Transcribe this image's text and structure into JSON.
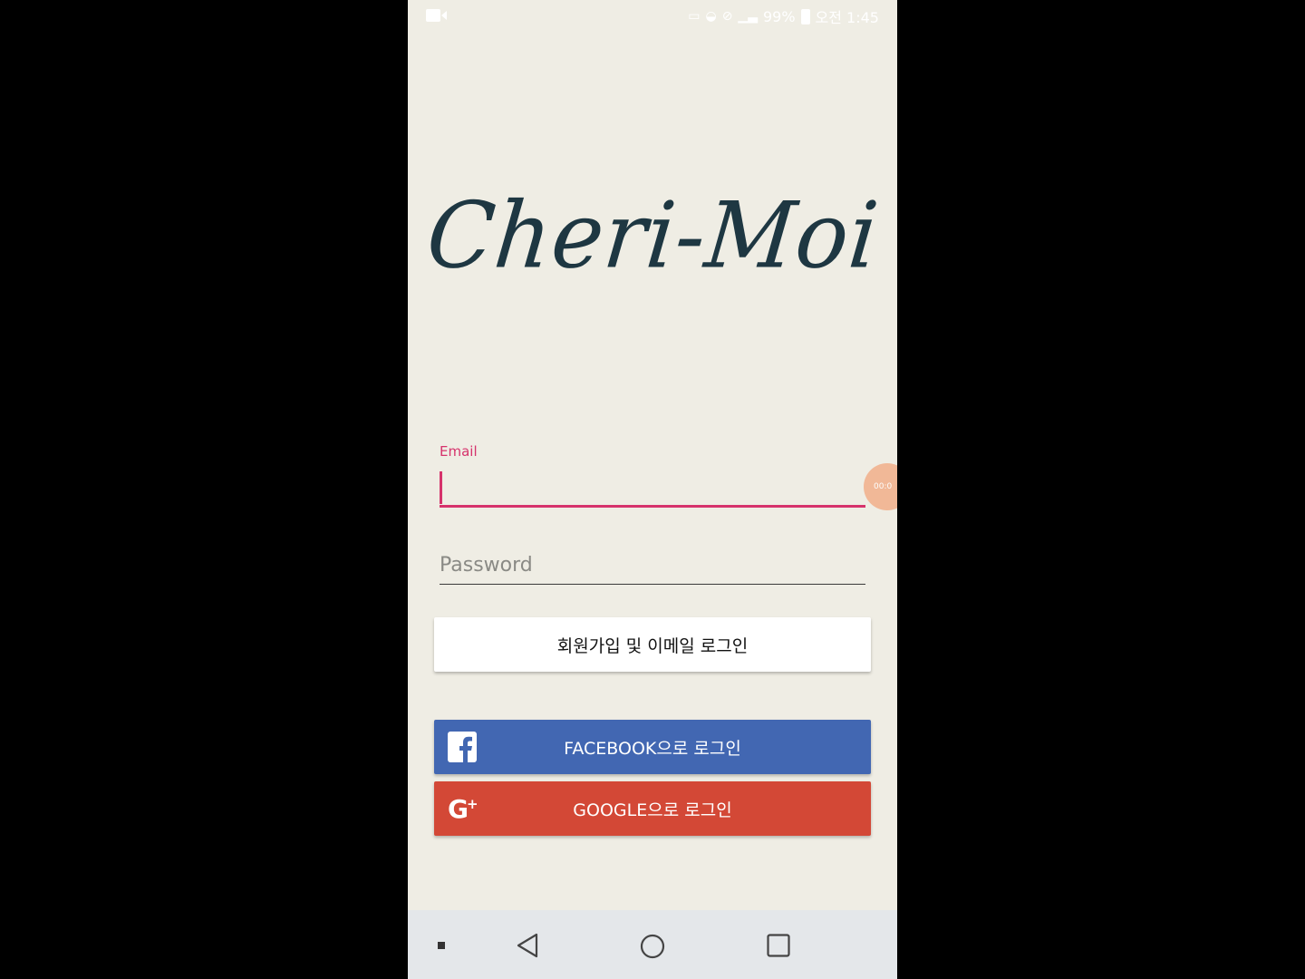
{
  "status_bar": {
    "battery": "99%",
    "time": "오전 1:45",
    "icons": [
      "video-record-icon",
      "nfc-icon",
      "wifi-icon",
      "mute-icon",
      "signal-icon",
      "battery-icon"
    ]
  },
  "logo": {
    "text": "Cheri-Moi"
  },
  "form": {
    "email_label": "Email",
    "password_placeholder": "Password"
  },
  "buttons": {
    "email_signup": "회원가입 및 이메일 로그인",
    "facebook": "FACEBOOK으로 로그인",
    "google": "GOOGLE으로 로그인"
  },
  "overlay": {
    "timer": "00:0"
  },
  "colors": {
    "background": "#efede4",
    "accent": "#d6336c",
    "facebook": "#4267b2",
    "google": "#d34836",
    "logo": "#1e3742"
  }
}
